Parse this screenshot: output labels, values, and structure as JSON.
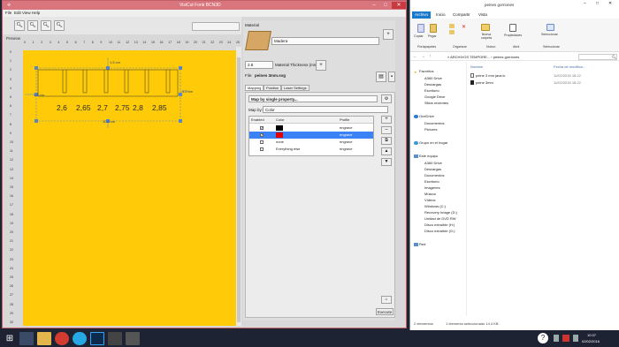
{
  "visicut": {
    "title": "VisiCut Fonk BCN3D",
    "menu": [
      "File",
      "Edit",
      "View",
      "Help"
    ],
    "toolbar_icons": [
      "zoom-in-icon",
      "zoom-out-icon",
      "zoom-fit-icon",
      "zoom-reset-icon"
    ],
    "preview_label": "Preview",
    "ruler_top": [
      "0",
      "1",
      "2",
      "3",
      "4",
      "5",
      "6",
      "7",
      "8",
      "9",
      "10",
      "11",
      "12",
      "13",
      "14",
      "15",
      "16",
      "17",
      "18",
      "19",
      "20",
      "21",
      "22",
      "23",
      "24",
      "25"
    ],
    "ruler_left": [
      "0",
      "1",
      "2",
      "3",
      "4",
      "5",
      "6",
      "7",
      "8",
      "9",
      "10",
      "11",
      "12",
      "13",
      "14",
      "15",
      "16",
      "17",
      "18",
      "19",
      "20",
      "21",
      "22",
      "23",
      "24",
      "25",
      "26",
      "27",
      "28",
      "29",
      "30"
    ],
    "design": {
      "labels": [
        "2,6",
        "2,65",
        "2,7",
        "2,75",
        "2,8",
        "2,85"
      ],
      "dim_top": "1,5 cm",
      "dim_left": "1,0 cm",
      "dim_right": "4,0 cm",
      "dim_bottom": "10,9 cm"
    },
    "material": {
      "section_label": "Material",
      "name": "Madera",
      "thickness_value": "2.8",
      "thickness_label": "Material Thickness (mm)",
      "file_label": "File:",
      "file_name": "peines 3mm.svg"
    },
    "tabs": [
      "Mapping",
      "Position",
      "Laser Settings"
    ],
    "mapping": {
      "dropdown": "Map by single property...",
      "map_by_label": "Map by:",
      "map_by_value": "Color",
      "columns": [
        "Enabled",
        "Color",
        "Profile"
      ],
      "rows": [
        {
          "enabled": true,
          "color": "#000000",
          "label": "",
          "profile": "engrave",
          "selected": false
        },
        {
          "enabled": true,
          "color": "#e00000",
          "label": "",
          "profile": "engrave",
          "selected": true
        },
        {
          "enabled": false,
          "color": "",
          "label": "none",
          "profile": "engrave",
          "selected": false
        },
        {
          "enabled": false,
          "color": "",
          "label": "Everything else",
          "profile": "engrave",
          "selected": false
        }
      ]
    },
    "execute_label": "Execute",
    "accent_yellow": "#ffcb08"
  },
  "explorer": {
    "title": "peines gorriones",
    "tabs": [
      "Archivo",
      "Inicio",
      "Compartir",
      "Vista"
    ],
    "ribbon": {
      "groups": [
        "Portapapeles",
        "Organizar",
        "Nuevo",
        "Abrir",
        "Seleccionar"
      ],
      "buttons": [
        "Copiar",
        "Pegar",
        "Nueva carpeta",
        "Propiedades",
        "Seleccionar"
      ]
    },
    "address": "« ARCHIVOS TEMPORE... › peines gorriones",
    "columns": [
      "Nombre",
      "Fecha de modifica..."
    ],
    "files": [
      {
        "name": "peine 3 mm java.lc",
        "date": "11/02/2016 16:22"
      },
      {
        "name": "peine 3mm",
        "date": "11/02/2016 16:22"
      }
    ],
    "nav": [
      "Favoritos",
      "A360 Drive",
      "Descargas",
      "Escritorio",
      "Google Drive",
      "Sitios recientes",
      "OneDrive",
      "Documentos",
      "Pictures",
      "Grupo en el hogar",
      "Este equipo",
      "A360 Drive",
      "Descargas",
      "Documentos",
      "Escritorio",
      "Imágenes",
      "Música",
      "Vídeos",
      "Windows (C:)",
      "Recovery Image (D:)",
      "Unidad de DVD RW",
      "Disco extraíble (H:)",
      "Disco extraíble (G:)",
      "Red"
    ],
    "status_count": "2 elementos",
    "status_selected": "1 elemento seleccionado 14,4 KB"
  },
  "taskbar": {
    "icons": [
      "start-icon",
      "file-explorer-icon",
      "folder-icon",
      "chrome-icon",
      "skype-icon",
      "photoshop-icon",
      "inkscape-icon",
      "visicut-icon"
    ],
    "clock_time": "10:37",
    "clock_date": "02/02/2016"
  }
}
